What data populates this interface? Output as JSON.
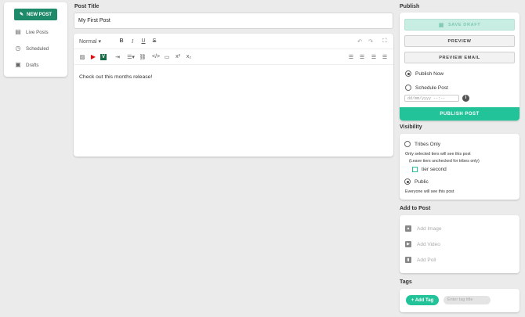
{
  "sidebar": {
    "new_post": "NEW POST",
    "items": [
      {
        "label": "Live Posts",
        "icon": "list-icon"
      },
      {
        "label": "Scheduled",
        "icon": "clock-icon"
      },
      {
        "label": "Drafts",
        "icon": "floppy-icon"
      }
    ]
  },
  "post": {
    "title_label": "Post Title",
    "title_value": "My First Post",
    "body": "Check out this months release!"
  },
  "toolbar": {
    "format": "Normal",
    "icons": [
      "bold-icon",
      "italic-icon",
      "underline-icon",
      "strikethrough-icon",
      "undo-icon",
      "redo-icon",
      "fullscreen-icon",
      "image-icon",
      "youtube-icon",
      "vimeo-icon",
      "indent-icon",
      "list-icon",
      "link-icon",
      "code-icon",
      "embed-icon",
      "superscript-icon",
      "subscript-icon",
      "align-left-icon",
      "align-center-icon",
      "align-right-icon",
      "justify-icon"
    ]
  },
  "publish": {
    "heading": "Publish",
    "save_draft": "SAVE DRAFT",
    "preview": "PREVIEW",
    "preview_email": "PREVIEW EMAIL",
    "publish_now": "Publish Now",
    "schedule_post": "Schedule Post",
    "date_placeholder": "dd/mm/yyyy --:--",
    "publish_post": "PUBLISH POST",
    "selected": "publish_now"
  },
  "visibility": {
    "heading": "Visibility",
    "tribes_only": "Tribes Only",
    "tribes_note": "Only selected tiers will see this post",
    "tribes_note2": "(Leave tiers unchecked for tribes only)",
    "tier": "tier second",
    "public": "Public",
    "public_note": "Everyone will see this post",
    "selected": "public"
  },
  "add_to_post": {
    "heading": "Add to Post",
    "items": [
      "Add Image",
      "Add Video",
      "Add Poll"
    ]
  },
  "tags": {
    "heading": "Tags",
    "add_tag": "+ Add Tag",
    "placeholder": "Enter tag title"
  },
  "colors": {
    "accent": "#23c39a",
    "new_post": "#1e8a6a",
    "background": "#ebebeb"
  }
}
